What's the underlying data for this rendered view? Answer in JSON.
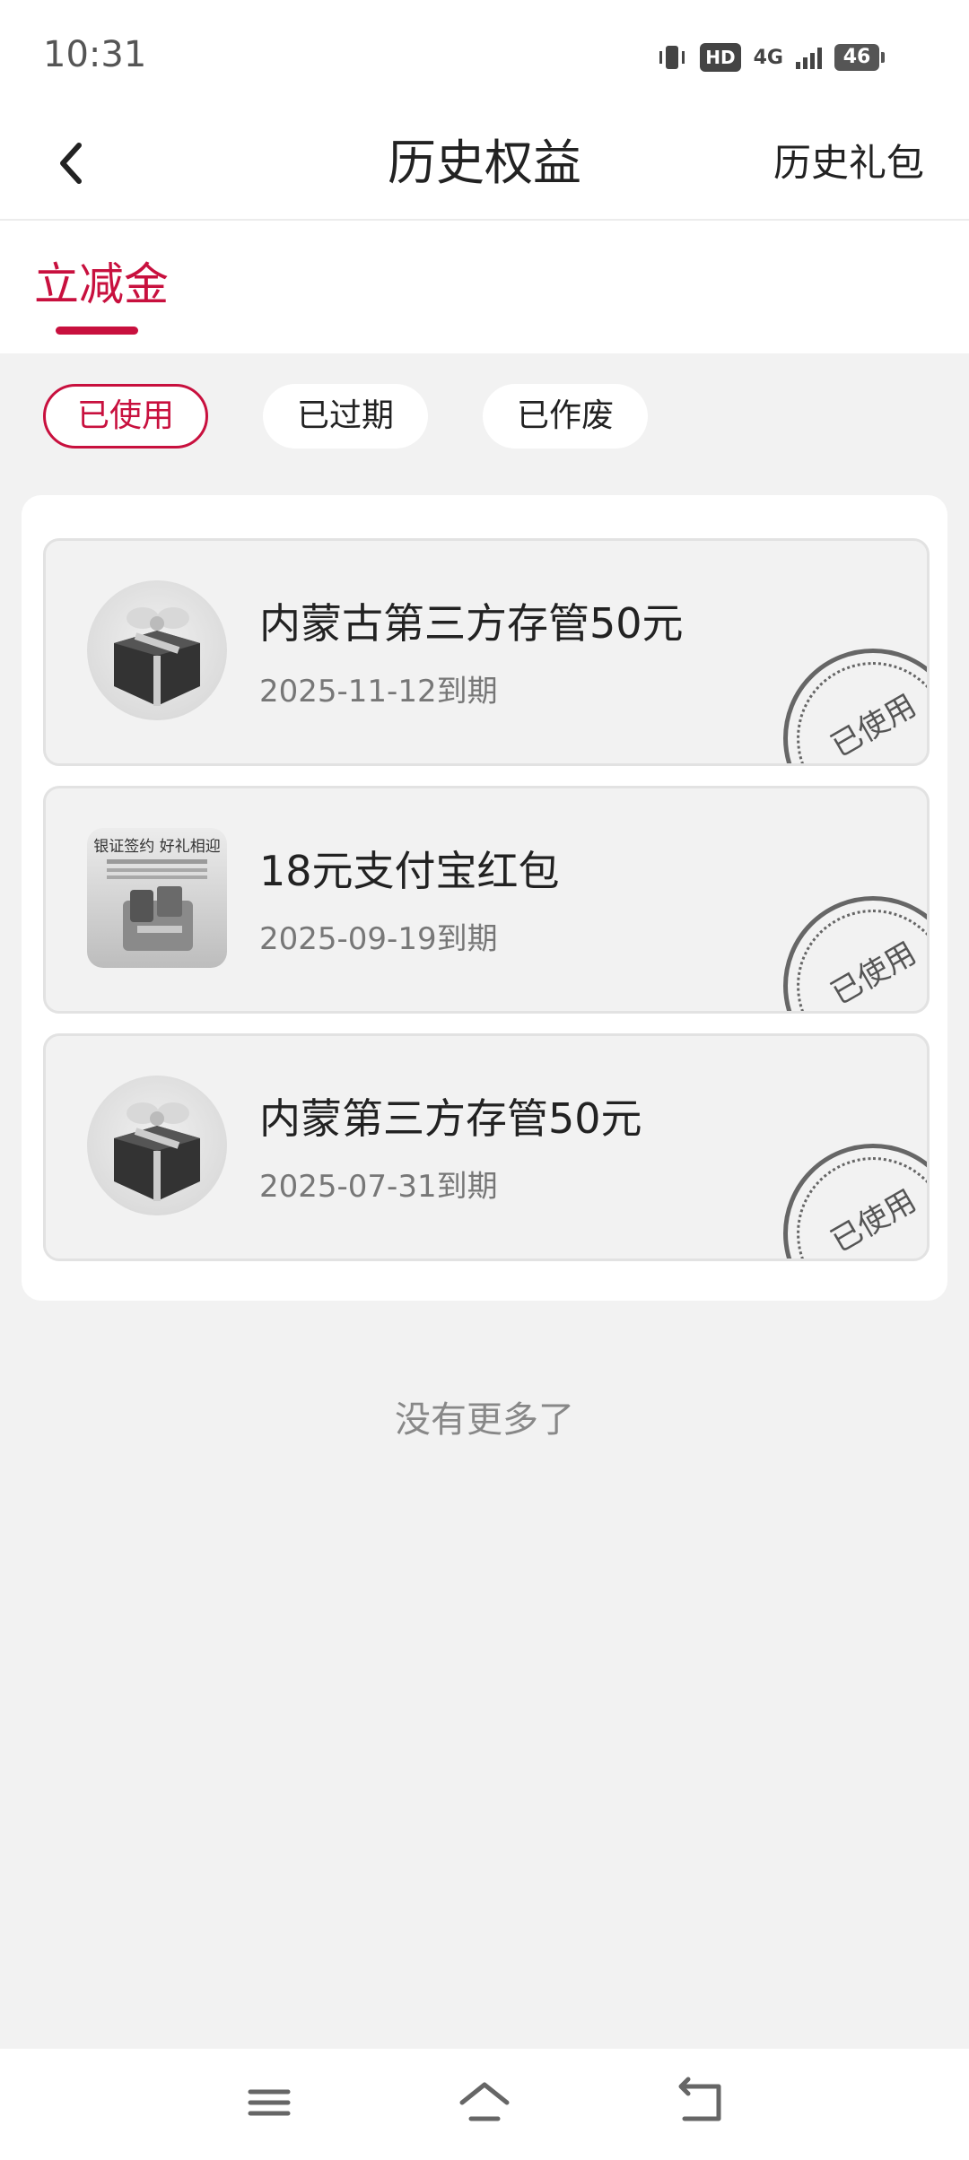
{
  "status_bar": {
    "time": "10:31",
    "hd_label": "HD",
    "network_label": "4G",
    "battery_level": "46"
  },
  "nav": {
    "title": "历史权益",
    "right_action": "历史礼包"
  },
  "tabs": [
    {
      "label": "立减金",
      "active": true
    }
  ],
  "filters": [
    {
      "label": "已使用",
      "active": true
    },
    {
      "label": "已过期",
      "active": false
    },
    {
      "label": "已作废",
      "active": false
    }
  ],
  "coupons": [
    {
      "title": "内蒙古第三方存管50元",
      "expiry": "2025-11-12到期",
      "stamp": "已使用",
      "image": "gift-box-icon"
    },
    {
      "title": "18元支付宝红包",
      "expiry": "2025-09-19到期",
      "stamp": "已使用",
      "image": "promo-thumbnail",
      "image_heading": "银证签约 好礼相迎"
    },
    {
      "title": "内蒙第三方存管50元",
      "expiry": "2025-07-31到期",
      "stamp": "已使用",
      "image": "gift-box-icon"
    }
  ],
  "footer_text": "没有更多了",
  "accent_color": "#c8103e"
}
